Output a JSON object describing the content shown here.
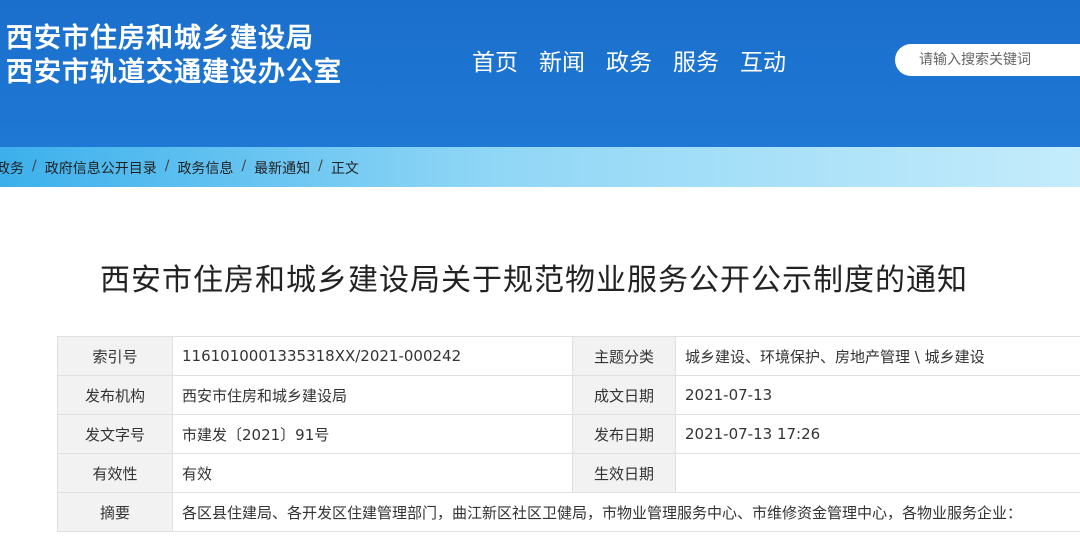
{
  "header": {
    "title_line1": "西安市住房和城乡建设局",
    "title_line2": "西安市轨道交通建设办公室",
    "nav": [
      "首页",
      "新闻",
      "政务",
      "服务",
      "互动"
    ],
    "search_placeholder": "请输入搜索关键词"
  },
  "breadcrumb": [
    "政务",
    "政府信息公开目录",
    "政务信息",
    "最新通知",
    "正文"
  ],
  "article": {
    "title": "西安市住房和城乡建设局关于规范物业服务公开公示制度的通知"
  },
  "meta": {
    "index_label": "索引号",
    "index_value": "1161010001335318XX/2021-000242",
    "topic_label": "主题分类",
    "topic_value": "城乡建设、环境保护、房地产管理 \\ 城乡建设",
    "publisher_label": "发布机构",
    "publisher_value": "西安市住房和城乡建设局",
    "created_label": "成文日期",
    "created_value": "2021-07-13",
    "doc_no_label": "发文字号",
    "doc_no_value": "市建发〔2021〕91号",
    "published_label": "发布日期",
    "published_value": "2021-07-13 17:26",
    "validity_label": "有效性",
    "validity_value": "有效",
    "effective_label": "生效日期",
    "effective_value": "",
    "abstract_label": "摘要",
    "abstract_value": "各区县住建局、各开发区住建管理部门，曲江新区社区卫健局，市物业管理服务中心、市维修资金管理中心，各物业服务企业："
  }
}
